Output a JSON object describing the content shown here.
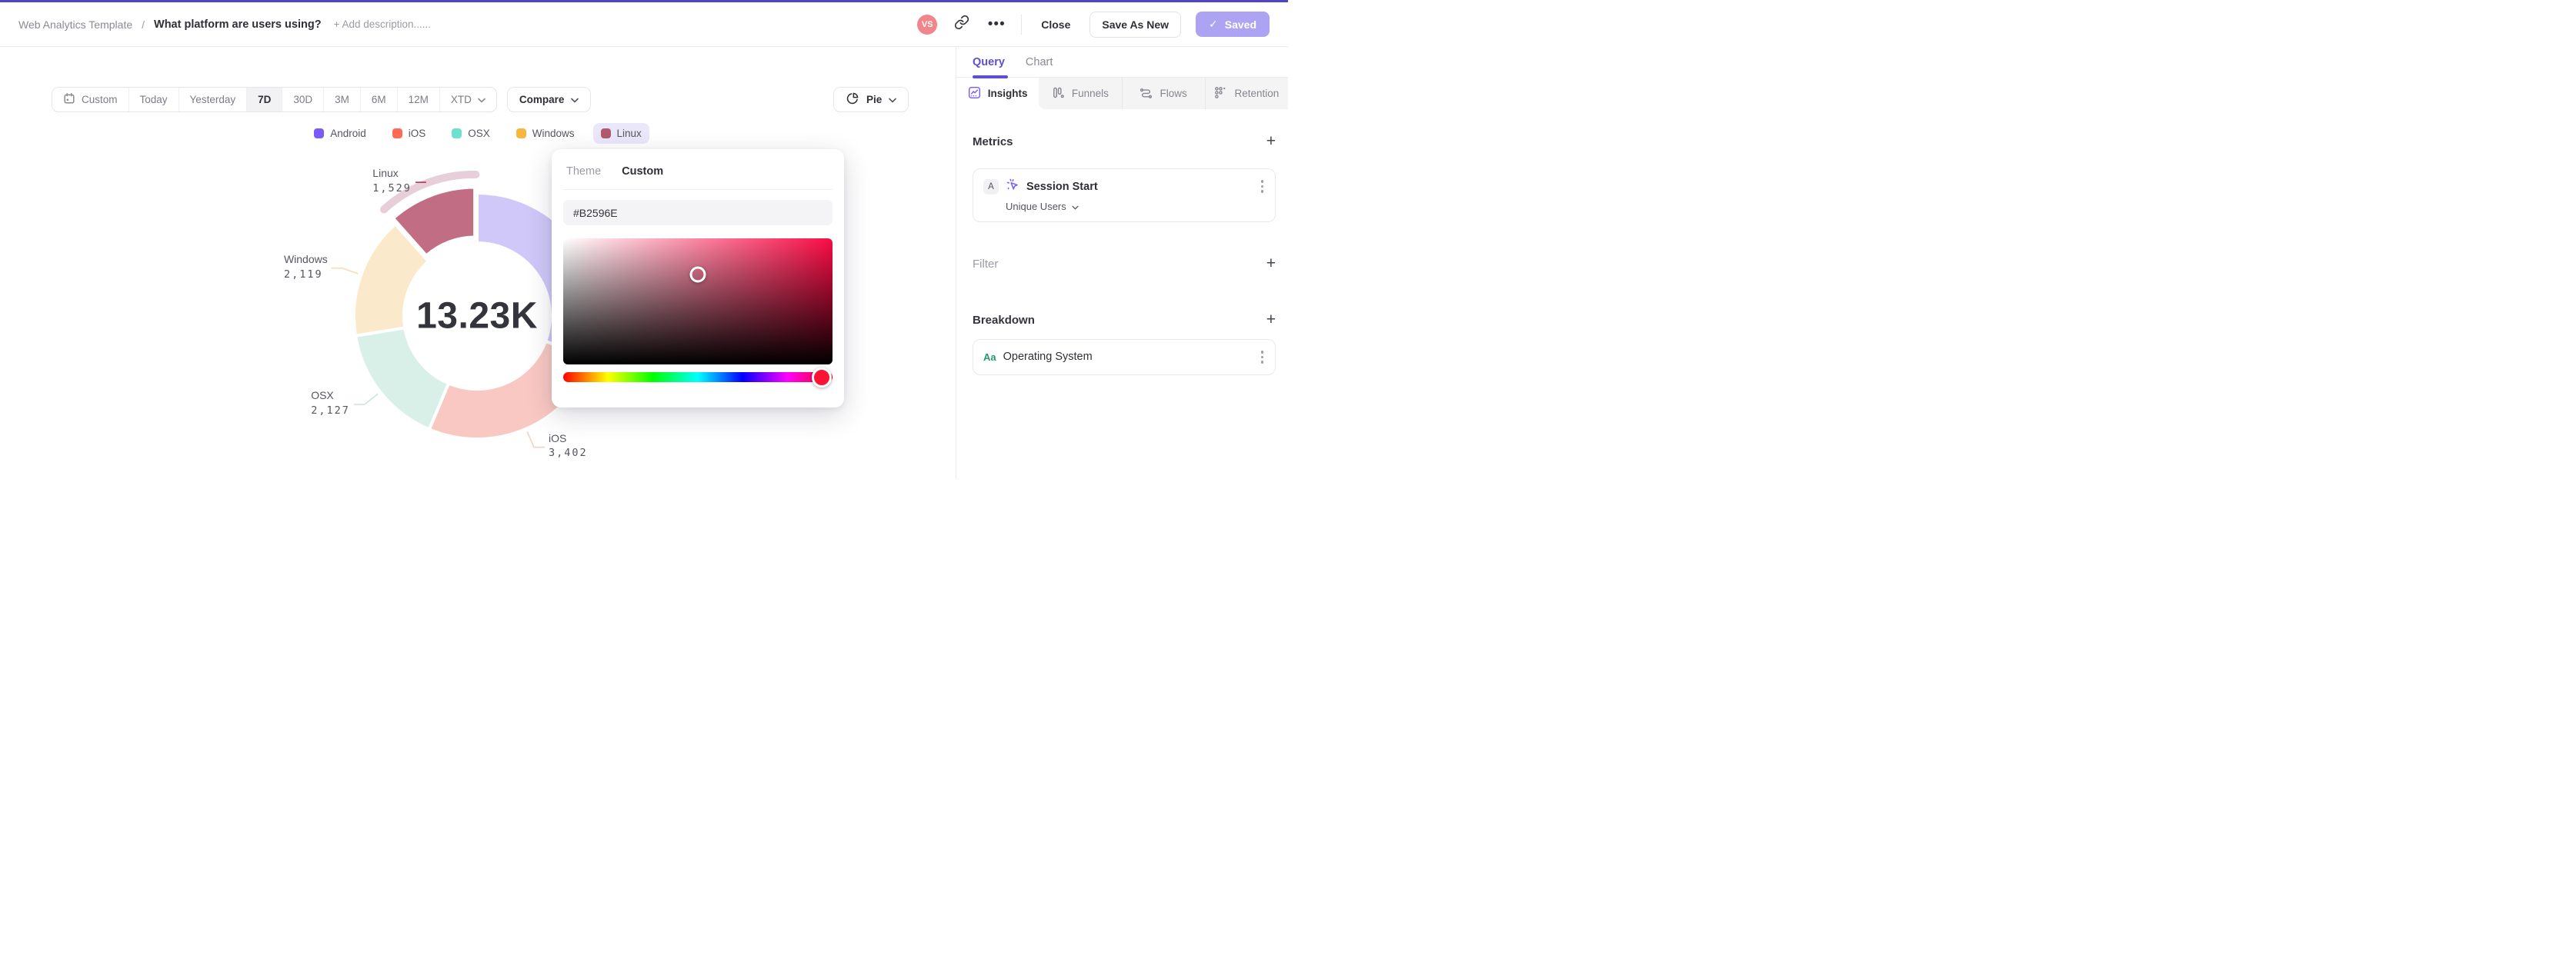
{
  "colors": {
    "top_accent": "#5044CB",
    "accent_purple": "#5B4FD6",
    "saved_button_bg": "#ADA3F3",
    "avatar_bg": "#F0868C",
    "legend_selected_bg": "#EAE7FB"
  },
  "header": {
    "breadcrumb": "Web Analytics Template",
    "separator": "/",
    "title": "What platform are users using?",
    "add_description": "+ Add description......",
    "avatar_initials": "VS",
    "more_label": "•••",
    "close_label": "Close",
    "save_as_new_label": "Save As New",
    "saved_check": "✓",
    "saved_label": "Saved"
  },
  "toolbar": {
    "ranges": [
      {
        "label": "Custom",
        "selected": false
      },
      {
        "label": "Today",
        "selected": false
      },
      {
        "label": "Yesterday",
        "selected": false
      },
      {
        "label": "7D",
        "selected": true
      },
      {
        "label": "30D",
        "selected": false
      },
      {
        "label": "3M",
        "selected": false
      },
      {
        "label": "6M",
        "selected": false
      },
      {
        "label": "12M",
        "selected": false
      },
      {
        "label": "XTD",
        "selected": false
      }
    ],
    "compare_label": "Compare",
    "chart_type_label": "Pie"
  },
  "legend": {
    "items": [
      {
        "label": "Android",
        "color": "#7A5AF8",
        "selected": false
      },
      {
        "label": "iOS",
        "color": "#FF6A55",
        "selected": false
      },
      {
        "label": "OSX",
        "color": "#6FE0CE",
        "selected": false
      },
      {
        "label": "Windows",
        "color": "#F5B73F",
        "selected": false
      },
      {
        "label": "Linux",
        "color": "#B2596E",
        "selected": true
      }
    ]
  },
  "chart_data": {
    "type": "pie",
    "donut": true,
    "direction": "clockwise",
    "start_angle_deg": 0,
    "legend_position": "top",
    "center_label": "13.23K",
    "total": 13230,
    "categories": [
      "Android",
      "iOS",
      "OSX",
      "Windows",
      "Linux"
    ],
    "values": [
      4053,
      3402,
      2127,
      2119,
      1529
    ],
    "display_values": [
      "",
      "3,402",
      "2,127",
      "2,119",
      "1,529"
    ],
    "slice_fills": [
      "#CFC8F8",
      "#F9C8C2",
      "#D9F0E9",
      "#FBE9CB",
      "#C16E85"
    ],
    "leader_colors": [
      "#CFC8F8",
      "#F6CEC8",
      "#C9E8DD",
      "#F5DDB8",
      "#A43D5C"
    ],
    "label_visible": [
      false,
      true,
      true,
      true,
      true
    ],
    "selected_slice": "Linux",
    "selected_halo_color": "#E8CED8"
  },
  "color_picker": {
    "tabs": [
      {
        "label": "Theme",
        "active": false
      },
      {
        "label": "Custom",
        "active": true
      }
    ],
    "hex_value": "#B2596E",
    "gradient_hue": "#FA0C45",
    "cursor": {
      "x_pct": 50,
      "y_pct": 28.5
    },
    "hue_handle": {
      "x_pct": 96,
      "color": "#FB1433"
    }
  },
  "sidebar": {
    "tabs": [
      {
        "label": "Query",
        "active": true
      },
      {
        "label": "Chart",
        "active": false
      }
    ],
    "views": [
      {
        "label": "Insights",
        "active": true
      },
      {
        "label": "Funnels",
        "active": false
      },
      {
        "label": "Flows",
        "active": false
      },
      {
        "label": "Retention",
        "active": false
      }
    ],
    "metrics": {
      "heading": "Metrics",
      "add_label": "+",
      "card": {
        "badge": "A",
        "event": "Session Start",
        "measure": "Unique Users"
      }
    },
    "filter": {
      "heading": "Filter",
      "add_label": "+"
    },
    "breakdown": {
      "heading": "Breakdown",
      "add_label": "+",
      "card": {
        "badge": "Aa",
        "property": "Operating System"
      }
    }
  }
}
